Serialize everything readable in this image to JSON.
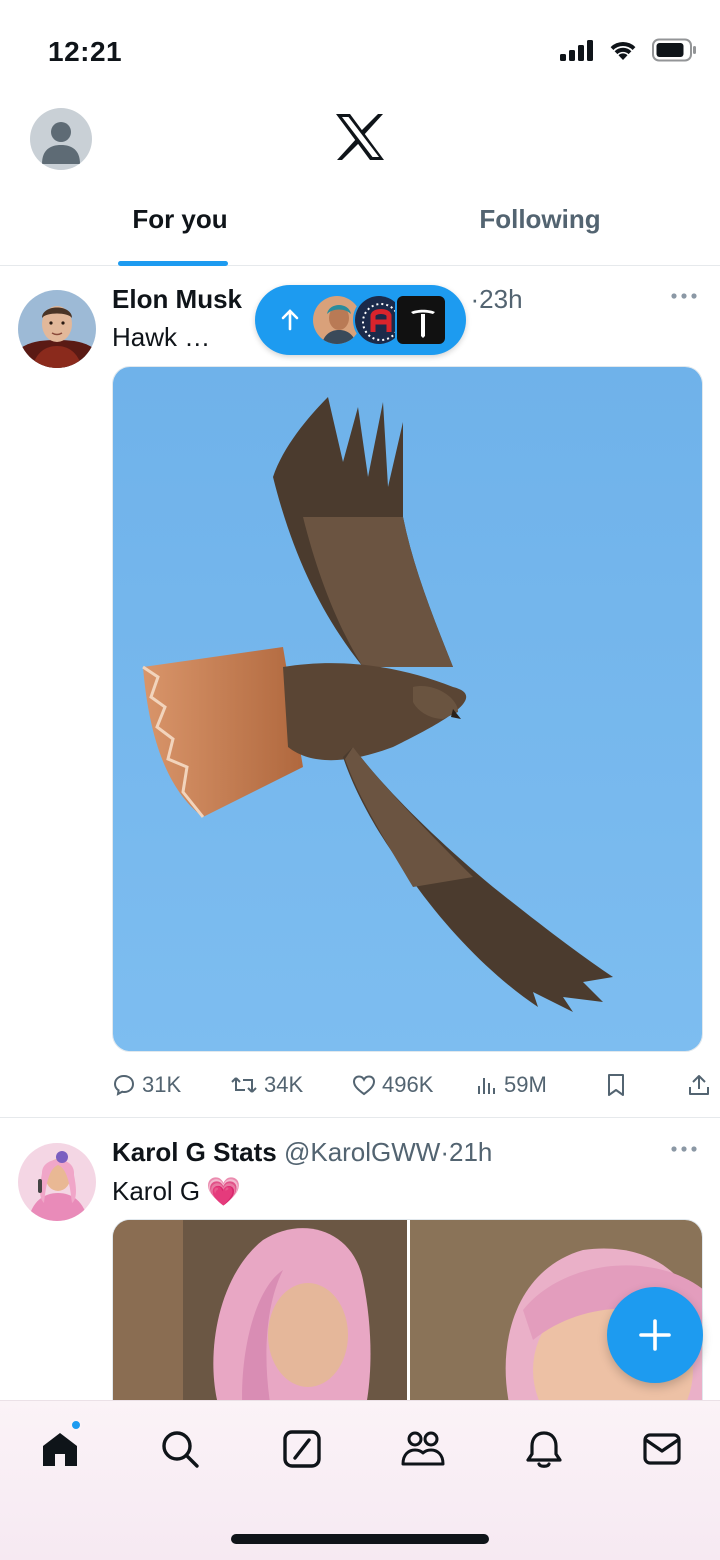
{
  "status_bar": {
    "time": "12:21"
  },
  "header": {
    "logo": "x-logo",
    "tabs": [
      {
        "label": "For you",
        "active": true
      },
      {
        "label": "Following",
        "active": false
      }
    ]
  },
  "tweets": [
    {
      "name": "Elon Musk",
      "meta": "·23h",
      "text": "Hawk …",
      "media": "photo of a red-tailed hawk in flight against blue sky",
      "actions": {
        "replies": "31K",
        "reposts": "34K",
        "likes": "496K",
        "views": "59M"
      }
    },
    {
      "name": "Karol G Stats",
      "meta": "@KarolGWW·21h",
      "text": "Karol G",
      "emoji": "💗",
      "media": "two photos of a woman with pink braided hair"
    }
  ],
  "new_posts_pill": {
    "icon": "arrow-up-icon",
    "avatars": 3
  },
  "colors": {
    "accent": "#1d9bf0",
    "text": "#0f1419",
    "secondary": "#536471",
    "border": "#e6e9ec"
  },
  "bottom_nav": [
    "home-icon",
    "search-icon",
    "grok-icon",
    "communities-icon",
    "notifications-icon",
    "messages-icon"
  ]
}
